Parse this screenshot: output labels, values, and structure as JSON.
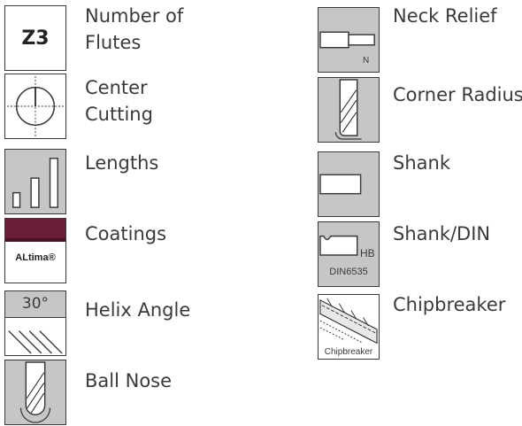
{
  "left_column": [
    {
      "label": "Number of Flutes",
      "line1": "Number of",
      "line2": "Flutes",
      "icon": "number-of-flutes-icon",
      "icon_text": "Z3"
    },
    {
      "label": "Center Cutting",
      "line1": "Center",
      "line2": "Cutting",
      "icon": "center-cutting-icon"
    },
    {
      "label": "Lengths",
      "icon": "lengths-icon"
    },
    {
      "label": "Coatings",
      "icon": "coatings-icon",
      "icon_text": "ALtima®"
    },
    {
      "label": "Helix Angle",
      "icon": "helix-angle-icon",
      "icon_text": "30°"
    },
    {
      "label": "Ball Nose",
      "icon": "ball-nose-icon"
    }
  ],
  "right_column": [
    {
      "label": "Neck Relief",
      "icon": "neck-relief-icon",
      "icon_text": "N"
    },
    {
      "label": "Corner Radius",
      "icon": "corner-radius-icon"
    },
    {
      "label": "Shank",
      "icon": "shank-icon"
    },
    {
      "label": "Shank/DIN",
      "icon": "shank-din-icon",
      "icon_text": "HB",
      "icon_subtext": "DIN6535"
    },
    {
      "label": "Chipbreaker",
      "icon": "chipbreaker-icon",
      "icon_text": "Chipbreaker"
    }
  ],
  "colors": {
    "text": "#3a3a3a",
    "icon_gray": "#c6c6c6",
    "coating_band": "#6b1e3a"
  }
}
